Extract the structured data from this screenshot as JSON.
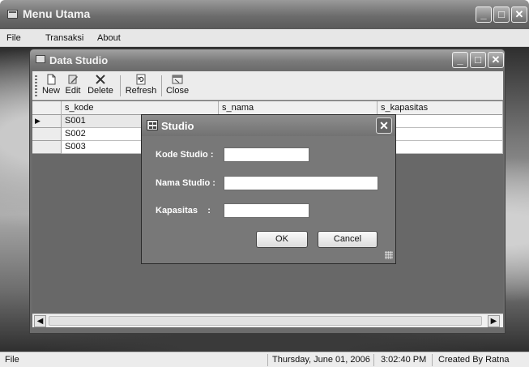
{
  "main_window": {
    "title": "Menu Utama",
    "menu": [
      "File",
      "Transaksi",
      "About"
    ],
    "caption_buttons": {
      "minimize": "_",
      "maximize": "□",
      "close": "✕"
    }
  },
  "child_window": {
    "title": "Data Studio",
    "toolbar": [
      {
        "label": "New",
        "icon": "new-doc-icon"
      },
      {
        "label": "Edit",
        "icon": "edit-icon"
      },
      {
        "label": "Delete",
        "icon": "delete-x-icon"
      },
      {
        "label": "Refresh",
        "icon": "refresh-icon"
      },
      {
        "label": "Close",
        "icon": "close-window-icon"
      }
    ],
    "grid": {
      "columns": [
        "s_kode",
        "s_nama",
        "s_kapasitas"
      ],
      "current_row_marker": "▶",
      "rows": [
        [
          "S001",
          "",
          ""
        ],
        [
          "S002",
          "",
          ""
        ],
        [
          "S003",
          "",
          ""
        ]
      ]
    },
    "hscroll": {
      "left_arrow": "◀",
      "right_arrow": "▶"
    }
  },
  "dialog": {
    "title": "Studio",
    "close_glyph": "✕",
    "fields": [
      {
        "label": "Kode Studio :",
        "value": ""
      },
      {
        "label": "Nama Studio :",
        "value": ""
      },
      {
        "label": "Kapasitas    :",
        "value": ""
      }
    ],
    "ok_label": "OK",
    "cancel_label": "Cancel"
  },
  "statusbar": {
    "left": "File",
    "date": "Thursday, June 01, 2006",
    "time": "3:02:40 PM",
    "credit": "Created By Ratna"
  },
  "colors": {
    "titlebar": "#7a7a7a",
    "mdi_background": "#6c6c6c",
    "dialog": "#787878"
  }
}
